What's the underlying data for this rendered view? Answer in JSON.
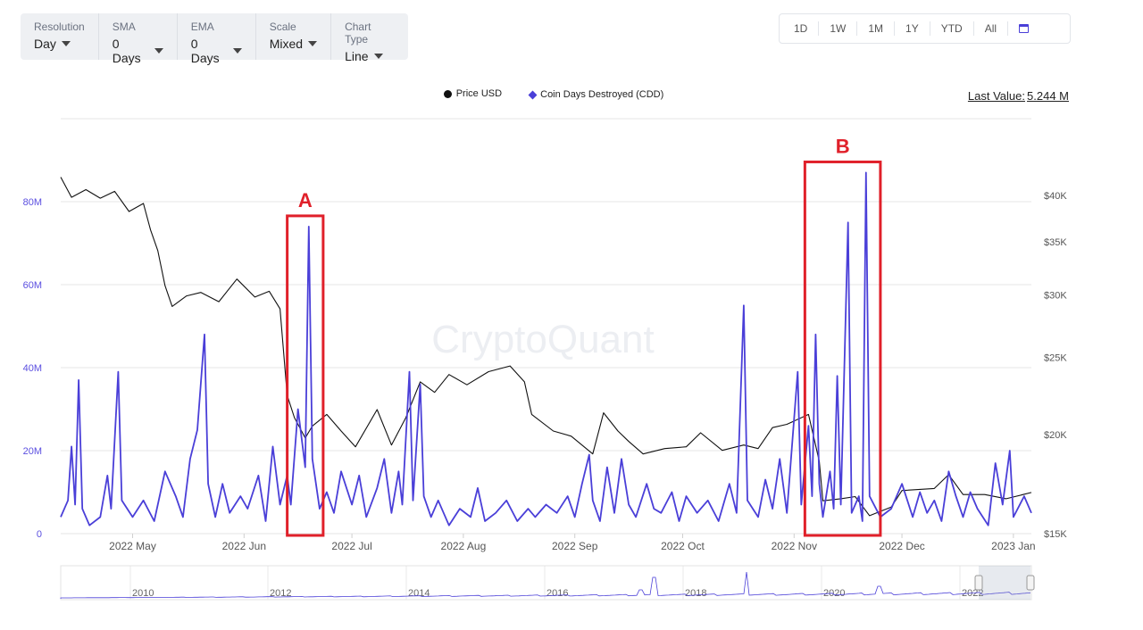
{
  "controls": [
    {
      "label": "Resolution",
      "value": "Day"
    },
    {
      "label": "SMA",
      "value": "0 Days"
    },
    {
      "label": "EMA",
      "value": "0 Days"
    },
    {
      "label": "Scale",
      "value": "Mixed"
    },
    {
      "label": "Chart Type",
      "value": "Line"
    }
  ],
  "ranges": [
    "1D",
    "1W",
    "1M",
    "1Y",
    "YTD",
    "All"
  ],
  "calendar_icon": "calendar-icon",
  "legend": {
    "price": "Price USD",
    "cdd": "Coin Days Destroyed (CDD)"
  },
  "last_value": {
    "label": "Last Value:",
    "value": "5.244 M"
  },
  "watermark": "CryptoQuant",
  "chart_data": {
    "type": "line",
    "colors": {
      "price": "#111111",
      "cdd": "#4a3fd8",
      "annotation": "#e0202a"
    },
    "x_ticks": [
      "2022 May",
      "2022 Jun",
      "2022 Jul",
      "2022 Aug",
      "2022 Sep",
      "2022 Oct",
      "2022 Nov",
      "2022 Dec",
      "2023 Jan"
    ],
    "x_range": [
      "2022-04-11",
      "2023-01-06"
    ],
    "y_left": {
      "ticks": [
        "0",
        "20M",
        "40M",
        "60M",
        "80M"
      ],
      "values": [
        0,
        20,
        40,
        60,
        80
      ],
      "unit": "M",
      "range": [
        0,
        100
      ]
    },
    "y_right": {
      "ticks": [
        "$15K",
        "$20K",
        "$25K",
        "$30K",
        "$35K",
        "$40K"
      ],
      "values": [
        15000,
        20000,
        25000,
        30000,
        35000,
        40000
      ],
      "scale": "log",
      "range": [
        15000,
        50000
      ]
    },
    "series": [
      {
        "name": "Price USD",
        "axis": "right",
        "points": [
          [
            "2022-04-11",
            42200
          ],
          [
            "2022-04-14",
            39800
          ],
          [
            "2022-04-18",
            40700
          ],
          [
            "2022-04-22",
            39700
          ],
          [
            "2022-04-26",
            40500
          ],
          [
            "2022-04-30",
            38200
          ],
          [
            "2022-05-04",
            39100
          ],
          [
            "2022-05-06",
            36200
          ],
          [
            "2022-05-08",
            34100
          ],
          [
            "2022-05-10",
            30800
          ],
          [
            "2022-05-12",
            29000
          ],
          [
            "2022-05-16",
            29900
          ],
          [
            "2022-05-20",
            30200
          ],
          [
            "2022-05-25",
            29400
          ],
          [
            "2022-05-30",
            31400
          ],
          [
            "2022-06-04",
            29800
          ],
          [
            "2022-06-08",
            30300
          ],
          [
            "2022-06-11",
            28800
          ],
          [
            "2022-06-13",
            22400
          ],
          [
            "2022-06-15",
            21000
          ],
          [
            "2022-06-18",
            19800
          ],
          [
            "2022-06-20",
            20500
          ],
          [
            "2022-06-24",
            21200
          ],
          [
            "2022-06-28",
            20200
          ],
          [
            "2022-07-02",
            19300
          ],
          [
            "2022-07-08",
            21500
          ],
          [
            "2022-07-12",
            19400
          ],
          [
            "2022-07-16",
            21000
          ],
          [
            "2022-07-20",
            23300
          ],
          [
            "2022-07-24",
            22600
          ],
          [
            "2022-07-28",
            23800
          ],
          [
            "2022-08-02",
            23100
          ],
          [
            "2022-08-08",
            24000
          ],
          [
            "2022-08-14",
            24400
          ],
          [
            "2022-08-18",
            23300
          ],
          [
            "2022-08-20",
            21200
          ],
          [
            "2022-08-26",
            20200
          ],
          [
            "2022-08-31",
            19900
          ],
          [
            "2022-09-06",
            18900
          ],
          [
            "2022-09-09",
            21300
          ],
          [
            "2022-09-13",
            20200
          ],
          [
            "2022-09-16",
            19600
          ],
          [
            "2022-09-20",
            18900
          ],
          [
            "2022-09-26",
            19200
          ],
          [
            "2022-10-02",
            19300
          ],
          [
            "2022-10-06",
            20100
          ],
          [
            "2022-10-12",
            19100
          ],
          [
            "2022-10-18",
            19400
          ],
          [
            "2022-10-22",
            19200
          ],
          [
            "2022-10-26",
            20400
          ],
          [
            "2022-10-30",
            20600
          ],
          [
            "2022-11-05",
            21200
          ],
          [
            "2022-11-08",
            18500
          ],
          [
            "2022-11-09",
            16500
          ],
          [
            "2022-11-14",
            16600
          ],
          [
            "2022-11-18",
            16700
          ],
          [
            "2022-11-22",
            15800
          ],
          [
            "2022-11-28",
            16200
          ],
          [
            "2022-12-01",
            17000
          ],
          [
            "2022-12-10",
            17100
          ],
          [
            "2022-12-14",
            17800
          ],
          [
            "2022-12-18",
            16800
          ],
          [
            "2022-12-24",
            16800
          ],
          [
            "2022-12-30",
            16600
          ],
          [
            "2023-01-06",
            16900
          ]
        ]
      },
      {
        "name": "Coin Days Destroyed (CDD)",
        "axis": "left",
        "unit": "M",
        "points": [
          [
            "2022-04-11",
            4
          ],
          [
            "2022-04-13",
            8
          ],
          [
            "2022-04-14",
            21
          ],
          [
            "2022-04-15",
            7
          ],
          [
            "2022-04-16",
            37
          ],
          [
            "2022-04-17",
            6
          ],
          [
            "2022-04-19",
            2
          ],
          [
            "2022-04-22",
            4
          ],
          [
            "2022-04-24",
            14
          ],
          [
            "2022-04-25",
            6
          ],
          [
            "2022-04-27",
            39
          ],
          [
            "2022-04-28",
            8
          ],
          [
            "2022-05-01",
            4
          ],
          [
            "2022-05-04",
            8
          ],
          [
            "2022-05-07",
            3
          ],
          [
            "2022-05-10",
            15
          ],
          [
            "2022-05-13",
            9
          ],
          [
            "2022-05-15",
            4
          ],
          [
            "2022-05-17",
            18
          ],
          [
            "2022-05-19",
            25
          ],
          [
            "2022-05-21",
            48
          ],
          [
            "2022-05-22",
            12
          ],
          [
            "2022-05-24",
            4
          ],
          [
            "2022-05-26",
            12
          ],
          [
            "2022-05-28",
            5
          ],
          [
            "2022-05-31",
            9
          ],
          [
            "2022-06-02",
            6
          ],
          [
            "2022-06-05",
            14
          ],
          [
            "2022-06-07",
            3
          ],
          [
            "2022-06-09",
            21
          ],
          [
            "2022-06-11",
            7
          ],
          [
            "2022-06-13",
            14
          ],
          [
            "2022-06-14",
            7
          ],
          [
            "2022-06-16",
            30
          ],
          [
            "2022-06-18",
            16
          ],
          [
            "2022-06-19",
            74
          ],
          [
            "2022-06-20",
            18
          ],
          [
            "2022-06-22",
            6
          ],
          [
            "2022-06-24",
            10
          ],
          [
            "2022-06-26",
            5
          ],
          [
            "2022-06-28",
            15
          ],
          [
            "2022-07-01",
            7
          ],
          [
            "2022-07-03",
            14
          ],
          [
            "2022-07-05",
            4
          ],
          [
            "2022-07-08",
            11
          ],
          [
            "2022-07-10",
            18
          ],
          [
            "2022-07-12",
            5
          ],
          [
            "2022-07-14",
            15
          ],
          [
            "2022-07-15",
            7
          ],
          [
            "2022-07-17",
            39
          ],
          [
            "2022-07-18",
            8
          ],
          [
            "2022-07-20",
            36
          ],
          [
            "2022-07-21",
            9
          ],
          [
            "2022-07-23",
            4
          ],
          [
            "2022-07-25",
            8
          ],
          [
            "2022-07-28",
            2
          ],
          [
            "2022-07-31",
            6
          ],
          [
            "2022-08-03",
            4
          ],
          [
            "2022-08-05",
            11
          ],
          [
            "2022-08-07",
            3
          ],
          [
            "2022-08-10",
            5
          ],
          [
            "2022-08-13",
            8
          ],
          [
            "2022-08-16",
            3
          ],
          [
            "2022-08-19",
            6
          ],
          [
            "2022-08-21",
            4
          ],
          [
            "2022-08-24",
            7
          ],
          [
            "2022-08-27",
            5
          ],
          [
            "2022-08-30",
            9
          ],
          [
            "2022-09-01",
            4
          ],
          [
            "2022-09-03",
            12
          ],
          [
            "2022-09-05",
            19
          ],
          [
            "2022-09-06",
            8
          ],
          [
            "2022-09-08",
            3
          ],
          [
            "2022-09-10",
            16
          ],
          [
            "2022-09-12",
            5
          ],
          [
            "2022-09-14",
            18
          ],
          [
            "2022-09-16",
            7
          ],
          [
            "2022-09-18",
            4
          ],
          [
            "2022-09-21",
            12
          ],
          [
            "2022-09-23",
            6
          ],
          [
            "2022-09-25",
            5
          ],
          [
            "2022-09-28",
            10
          ],
          [
            "2022-09-30",
            3
          ],
          [
            "2022-10-02",
            9
          ],
          [
            "2022-10-05",
            5
          ],
          [
            "2022-10-08",
            8
          ],
          [
            "2022-10-11",
            3
          ],
          [
            "2022-10-14",
            12
          ],
          [
            "2022-10-16",
            5
          ],
          [
            "2022-10-18",
            55
          ],
          [
            "2022-10-19",
            8
          ],
          [
            "2022-10-22",
            4
          ],
          [
            "2022-10-24",
            13
          ],
          [
            "2022-10-26",
            6
          ],
          [
            "2022-10-28",
            18
          ],
          [
            "2022-10-30",
            5
          ],
          [
            "2022-11-02",
            39
          ],
          [
            "2022-11-03",
            7
          ],
          [
            "2022-11-05",
            26
          ],
          [
            "2022-11-06",
            9
          ],
          [
            "2022-11-07",
            48
          ],
          [
            "2022-11-08",
            12
          ],
          [
            "2022-11-09",
            4
          ],
          [
            "2022-11-11",
            15
          ],
          [
            "2022-11-12",
            6
          ],
          [
            "2022-11-13",
            38
          ],
          [
            "2022-11-14",
            7
          ],
          [
            "2022-11-16",
            75
          ],
          [
            "2022-11-17",
            5
          ],
          [
            "2022-11-19",
            9
          ],
          [
            "2022-11-20",
            3
          ],
          [
            "2022-11-21",
            87
          ],
          [
            "2022-11-22",
            9
          ],
          [
            "2022-11-25",
            4
          ],
          [
            "2022-11-28",
            6
          ],
          [
            "2022-12-01",
            12
          ],
          [
            "2022-12-04",
            4
          ],
          [
            "2022-12-06",
            10
          ],
          [
            "2022-12-08",
            5
          ],
          [
            "2022-12-10",
            8
          ],
          [
            "2022-12-12",
            3
          ],
          [
            "2022-12-14",
            15
          ],
          [
            "2022-12-16",
            9
          ],
          [
            "2022-12-18",
            4
          ],
          [
            "2022-12-20",
            10
          ],
          [
            "2022-12-22",
            6
          ],
          [
            "2022-12-25",
            2
          ],
          [
            "2022-12-27",
            17
          ],
          [
            "2022-12-29",
            7
          ],
          [
            "2022-12-31",
            20
          ],
          [
            "2023-01-01",
            4
          ],
          [
            "2023-01-04",
            9
          ],
          [
            "2023-01-06",
            5
          ]
        ]
      }
    ],
    "annotations": [
      {
        "label": "A",
        "from": "2022-06-13",
        "to": "2022-06-23"
      },
      {
        "label": "B",
        "from": "2022-11-04",
        "to": "2022-11-25"
      }
    ],
    "navigator": {
      "ticks": [
        "2010",
        "2012",
        "2014",
        "2016",
        "2018",
        "2020",
        "2022"
      ]
    }
  }
}
